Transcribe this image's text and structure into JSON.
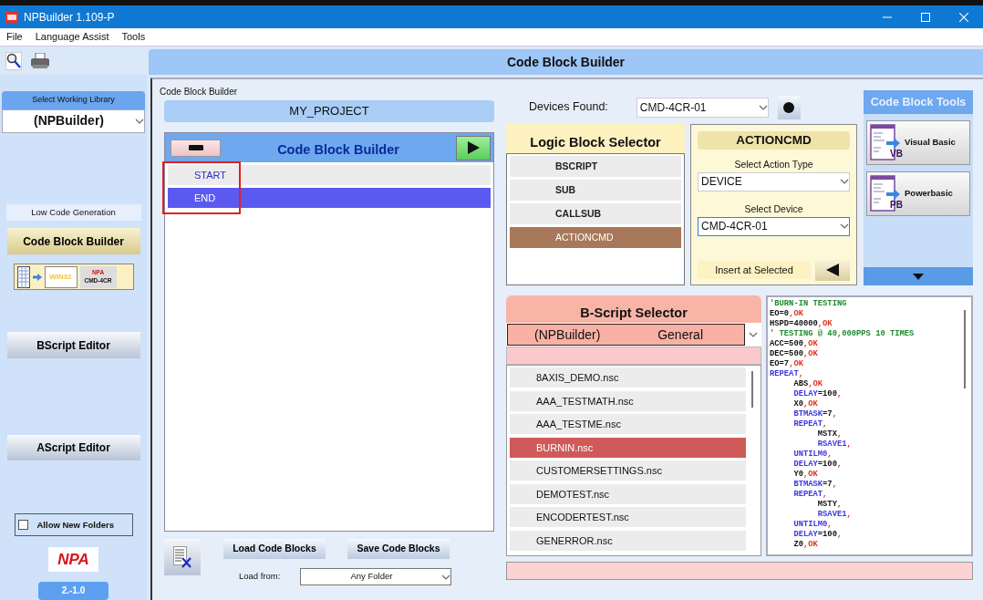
{
  "window": {
    "title": "NPBuilder  1.109-P"
  },
  "menu": [
    "File",
    "Language Assist",
    "Tools"
  ],
  "header": {
    "title": "Code Block Builder"
  },
  "sidebar": {
    "library_label": "Select Working Library",
    "library_value": "(NPBuilder)",
    "section_label": "Low Code Generation",
    "diagram": {
      "left_label": "WIN32",
      "brand": "NPA",
      "device": "CMD-4CR"
    },
    "buttons": [
      {
        "label": "Code Block Builder",
        "kind": "primary"
      },
      {
        "label": "BScript Editor",
        "kind": "plain"
      },
      {
        "label": "AScript Editor",
        "kind": "plain"
      }
    ],
    "allow_new_folders": {
      "label": "Allow New Folders",
      "checked": false
    },
    "logo": "NPA",
    "version": "2.-1.0"
  },
  "panel": {
    "title": "Code Block Builder"
  },
  "project": "MY_PROJECT",
  "builder": {
    "title": "Code Block Builder",
    "blocks": [
      {
        "label": "START",
        "selected": false
      },
      {
        "label": "END",
        "selected": true
      }
    ]
  },
  "builder_actions": {
    "load": "Load Code Blocks",
    "save": "Save Code Blocks",
    "load_from_label": "Load from:",
    "load_from_value": "Any Folder"
  },
  "devices": {
    "label": "Devices Found:",
    "value": "CMD-4CR-01"
  },
  "logic_selector": {
    "title": "Logic Block Selector",
    "items": [
      {
        "label": "BSCRIPT",
        "selected": false
      },
      {
        "label": "SUB",
        "selected": false
      },
      {
        "label": "CALLSUB",
        "selected": false
      },
      {
        "label": "ACTIONCMD",
        "selected": true
      }
    ]
  },
  "action": {
    "title": "ACTIONCMD",
    "type_label": "Select Action Type",
    "type_value": "DEVICE",
    "device_label": "Select Device",
    "device_value": "CMD-4CR-01",
    "insert_label": "Insert at Selected"
  },
  "tools": {
    "title": "Code Block Tools",
    "items": [
      {
        "label": "Visual Basic",
        "badge": "VB"
      },
      {
        "label": "Powerbasic",
        "badge": "PB"
      }
    ]
  },
  "bscript": {
    "title": "B-Script Selector",
    "library": "(NPBuilder)",
    "category": "General",
    "files": [
      {
        "label": "8AXIS_DEMO.nsc",
        "selected": false
      },
      {
        "label": "AAA_TESTMATH.nsc",
        "selected": false
      },
      {
        "label": "AAA_TESTME.nsc",
        "selected": false
      },
      {
        "label": "BURNIN.nsc",
        "selected": true
      },
      {
        "label": "CUSTOMERSETTINGS.nsc",
        "selected": false
      },
      {
        "label": "DEMOTEST.nsc",
        "selected": false
      },
      {
        "label": "ENCODERTEST.nsc",
        "selected": false
      },
      {
        "label": "GENERROR.nsc",
        "selected": false
      }
    ]
  },
  "code": [
    [
      {
        "kind": "comment",
        "text": "'BURN-IN TESTING"
      }
    ],
    [
      {
        "kind": "plain",
        "text": "EO=0"
      },
      {
        "kind": "ok",
        "text": ",OK"
      }
    ],
    [
      {
        "kind": "plain",
        "text": "HSPD=40000"
      },
      {
        "kind": "ok",
        "text": ",OK"
      }
    ],
    [
      {
        "kind": "comment",
        "text": "' TESTING @ 40,000PPS 10 TIMES"
      }
    ],
    [
      {
        "kind": "plain",
        "text": "ACC=500"
      },
      {
        "kind": "ok",
        "text": ",OK"
      }
    ],
    [
      {
        "kind": "plain",
        "text": "DEC=500"
      },
      {
        "kind": "ok",
        "text": ",OK"
      }
    ],
    [
      {
        "kind": "plain",
        "text": "EO=7"
      },
      {
        "kind": "ok",
        "text": ",OK"
      }
    ],
    [
      {
        "kind": "keyword",
        "text": "REPEAT"
      },
      {
        "kind": "ok",
        "text": ","
      }
    ],
    [
      {
        "kind": "plain",
        "text": "     ABS"
      },
      {
        "kind": "ok",
        "text": ",OK"
      }
    ],
    [
      {
        "kind": "keyword",
        "text": "     DELAY"
      },
      {
        "kind": "plain",
        "text": "=100"
      },
      {
        "kind": "ok",
        "text": ","
      }
    ],
    [
      {
        "kind": "plain",
        "text": "     X0"
      },
      {
        "kind": "ok",
        "text": ",OK"
      }
    ],
    [
      {
        "kind": "keyword",
        "text": "     BTMASK"
      },
      {
        "kind": "plain",
        "text": "=7"
      },
      {
        "kind": "ok",
        "text": ","
      }
    ],
    [
      {
        "kind": "keyword",
        "text": "     REPEAT"
      },
      {
        "kind": "ok",
        "text": ","
      }
    ],
    [
      {
        "kind": "plain",
        "text": "          MSTX"
      },
      {
        "kind": "ok",
        "text": ","
      }
    ],
    [
      {
        "kind": "keyword",
        "text": "          RSAVE1"
      },
      {
        "kind": "ok",
        "text": ","
      }
    ],
    [
      {
        "kind": "keyword",
        "text": "     UNTILM0"
      },
      {
        "kind": "ok",
        "text": ","
      }
    ],
    [
      {
        "kind": "keyword",
        "text": "     DELAY"
      },
      {
        "kind": "plain",
        "text": "=100"
      },
      {
        "kind": "ok",
        "text": ","
      }
    ],
    [
      {
        "kind": "plain",
        "text": "     Y0"
      },
      {
        "kind": "ok",
        "text": ",OK"
      }
    ],
    [
      {
        "kind": "keyword",
        "text": "     BTMASK"
      },
      {
        "kind": "plain",
        "text": "=7"
      },
      {
        "kind": "ok",
        "text": ","
      }
    ],
    [
      {
        "kind": "keyword",
        "text": "     REPEAT"
      },
      {
        "kind": "ok",
        "text": ","
      }
    ],
    [
      {
        "kind": "plain",
        "text": "          MSTY"
      },
      {
        "kind": "ok",
        "text": ","
      }
    ],
    [
      {
        "kind": "keyword",
        "text": "          RSAVE1"
      },
      {
        "kind": "ok",
        "text": ","
      }
    ],
    [
      {
        "kind": "keyword",
        "text": "     UNTILM0"
      },
      {
        "kind": "ok",
        "text": ","
      }
    ],
    [
      {
        "kind": "keyword",
        "text": "     DELAY"
      },
      {
        "kind": "plain",
        "text": "=100"
      },
      {
        "kind": "ok",
        "text": ","
      }
    ],
    [
      {
        "kind": "plain",
        "text": "     Z0"
      },
      {
        "kind": "ok",
        "text": ",OK"
      }
    ]
  ]
}
